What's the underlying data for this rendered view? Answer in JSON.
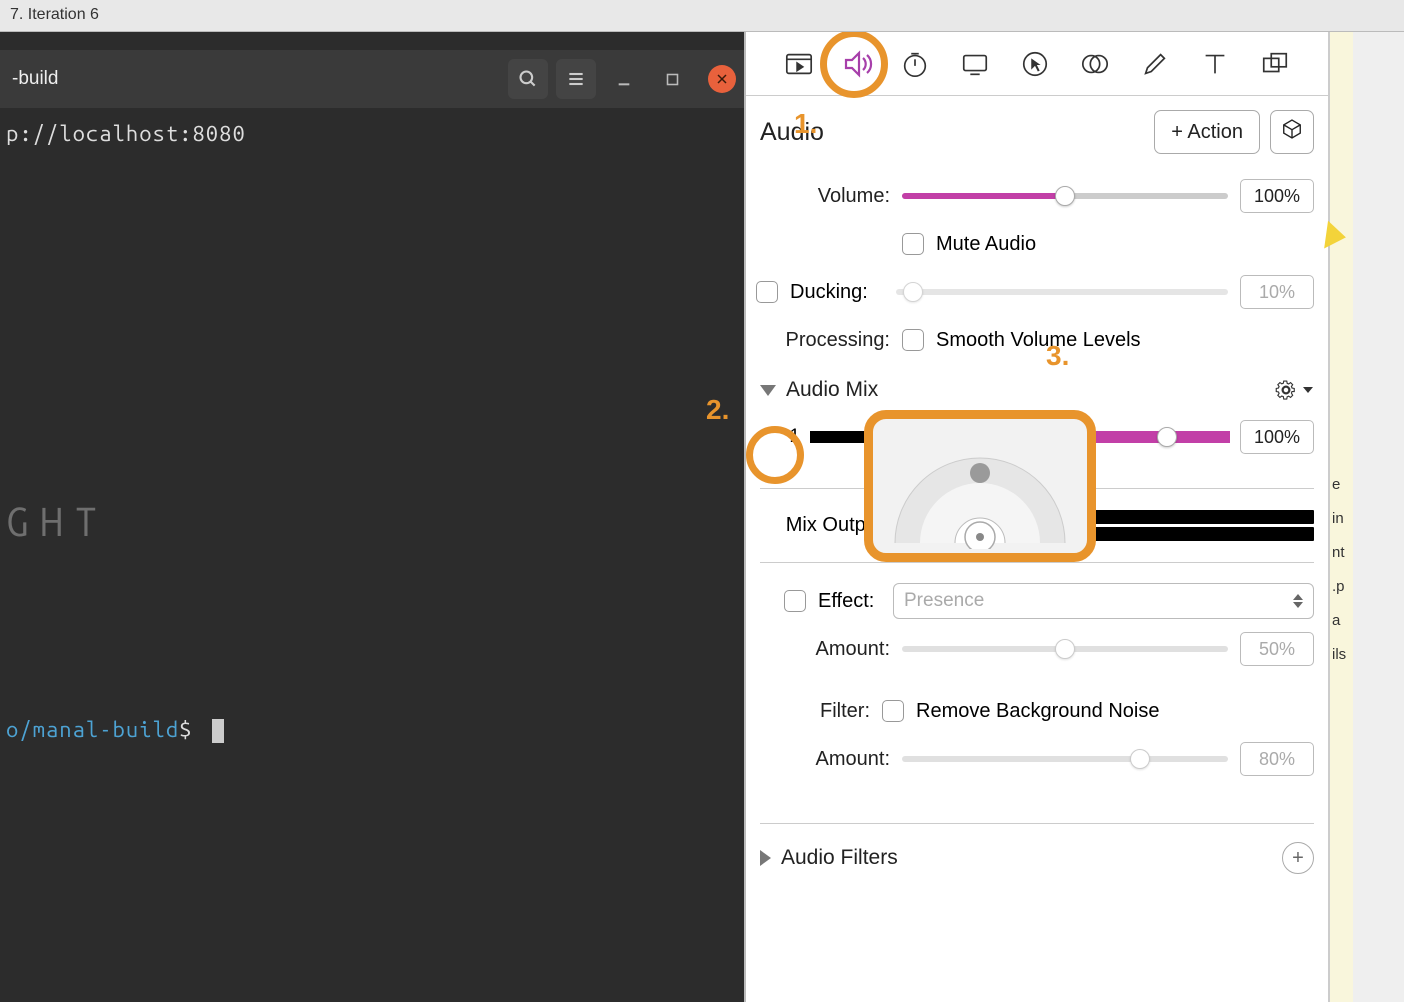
{
  "window_title": "7. Iteration 6",
  "terminal": {
    "title_suffix": "-build",
    "line1": "p://localhost:8080",
    "watermark": "GHT",
    "prompt_path": "o/manal-build",
    "prompt_sign": "$"
  },
  "inspector": {
    "panel_title": "Audio",
    "action_button": "+ Action",
    "volume": {
      "label": "Volume:",
      "value": "100%",
      "pct": 50
    },
    "mute": {
      "label": "Mute Audio"
    },
    "ducking": {
      "label": "Ducking:",
      "value": "10%",
      "pct": 5
    },
    "processing": {
      "label": "Processing:",
      "text": "Smooth Volume Levels"
    },
    "audio_mix": {
      "title": "Audio Mix",
      "track_num": "1",
      "value": "100%",
      "mix_output_label": "Mix Output:"
    },
    "effect": {
      "label": "Effect:",
      "selected": "Presence"
    },
    "amount1": {
      "label": "Amount:",
      "value": "50%",
      "pct": 50
    },
    "filter": {
      "label": "Filter:",
      "text": "Remove Background Noise"
    },
    "amount2": {
      "label": "Amount:",
      "value": "80%",
      "pct": 73
    },
    "audio_filters": {
      "title": "Audio Filters"
    }
  },
  "annotations": {
    "num1": "1.",
    "num2": "2.",
    "num3": "3."
  },
  "sliver": {
    "t1": "e",
    "t2": "in",
    "t3": "nt",
    "t4": ".p",
    "t5": "a",
    "t6": "ils"
  }
}
